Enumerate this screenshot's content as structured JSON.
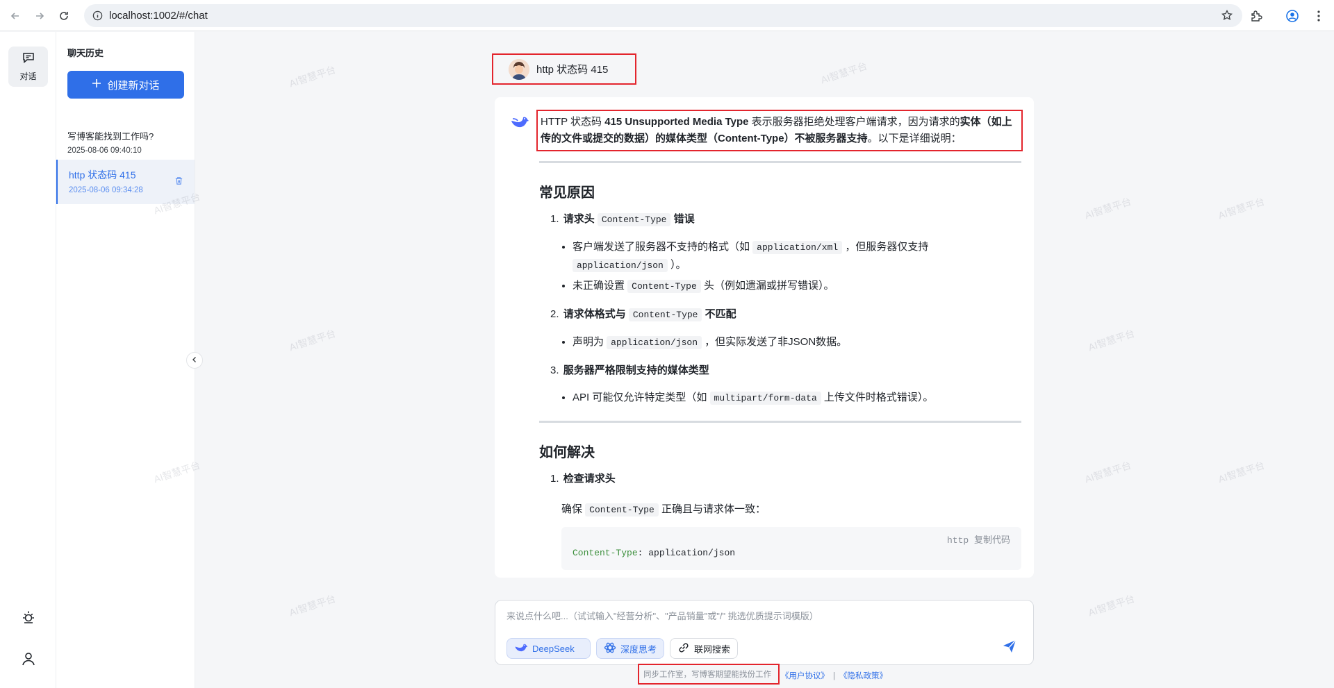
{
  "browser": {
    "url": "localhost:1002/#/chat"
  },
  "rail": {
    "chat_label": "对话"
  },
  "history": {
    "title": "聊天历史",
    "new_chat_label": "创建新对话",
    "items": [
      {
        "title": "写博客能找到工作吗?",
        "time": "2025-08-06 09:40:10"
      },
      {
        "title": "http 状态码 415",
        "time": "2025-08-06 09:34:28"
      }
    ]
  },
  "chat": {
    "user_message": "http 状态码 415",
    "intro": {
      "p1": "HTTP 状态码 ",
      "p2": "415 Unsupported Media Type",
      "p3": " 表示服务器拒绝处理客户端请求，因为请求的",
      "p4": "实体（如上传的文件或提交的数据）的媒体类型（Content-Type）不被服务器支持",
      "p5": "。以下是详细说明："
    },
    "section1": {
      "heading": "常见原因",
      "item1": {
        "num": "1.",
        "pre": "请求头 ",
        "code": "Content-Type",
        "post": " 错误",
        "b1_pre": "客户端发送了服务器不支持的格式（如 ",
        "b1_code1": "application/xml",
        "b1_mid": " ，但服务器仅支持 ",
        "b1_code2": "application/json",
        "b1_post": " ）。",
        "b2_pre": "未正确设置 ",
        "b2_code": "Content-Type",
        "b2_post": " 头（例如遗漏或拼写错误）。"
      },
      "item2": {
        "num": "2.",
        "pre": "请求体格式与 ",
        "code": "Content-Type",
        "post": " 不匹配",
        "b1_pre": "声明为 ",
        "b1_code": "application/json",
        "b1_post": " ，但实际发送了非JSON数据。"
      },
      "item3": {
        "num": "3.",
        "label": "服务器严格限制支持的媒体类型",
        "b1_pre": "API 可能仅允许特定类型（如 ",
        "b1_code": "multipart/form-data",
        "b1_post": " 上传文件时格式错误）。"
      }
    },
    "section2": {
      "heading": "如何解决",
      "item1": {
        "num": "1.",
        "label": "检查请求头"
      },
      "confirm_pre": "确保 ",
      "confirm_code": "Content-Type",
      "confirm_post": " 正确且与请求体一致：",
      "code_lang": "http 复制代码",
      "code_key": "Content-Type",
      "code_value": ": application/json"
    }
  },
  "input": {
    "placeholder": "来说点什么吧...（试试输入\"经营分析\"、\"产品销量\"或\"/\" 挑选优质提示词模版）",
    "chip_deepseek": "DeepSeek",
    "chip_think": "深度思考",
    "chip_web": "联网搜索"
  },
  "footer": {
    "text": "同步工作室，写博客期望能找份工作",
    "link1": "《用户协议》",
    "sep": "|",
    "link2": "《隐私政策》"
  },
  "watermark": "AI智慧平台",
  "colors": {
    "accent": "#2f6fe8",
    "highlight_border": "#e3252d"
  }
}
